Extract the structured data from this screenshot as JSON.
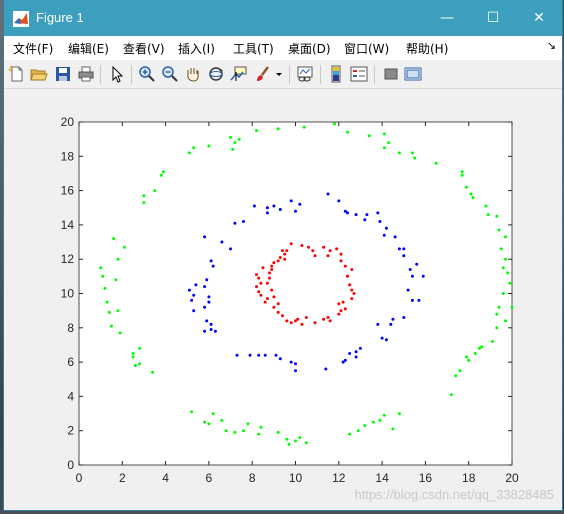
{
  "window": {
    "title": "Figure 1",
    "controls": {
      "minimize": "—",
      "maximize": "☐",
      "close": "✕"
    }
  },
  "menu": {
    "items": [
      "文件(F)",
      "编辑(E)",
      "查看(V)",
      "插入(I)",
      "工具(T)",
      "桌面(D)",
      "窗口(W)",
      "帮助(H)"
    ],
    "overflow": "↘"
  },
  "toolbar": {
    "buttons": [
      "new-figure-icon",
      "open-file-icon",
      "save-icon",
      "print-icon",
      "edit-plot-arrow-icon",
      "zoom-in-icon",
      "zoom-out-icon",
      "pan-hand-icon",
      "rotate-3d-icon",
      "data-cursor-icon",
      "brush-icon",
      "brush-dropdown-icon",
      "link-plot-icon",
      "insert-colorbar-icon",
      "insert-legend-icon",
      "hide-plot-tools-icon",
      "show-plot-tools-icon"
    ]
  },
  "colors": {
    "titlebar": "#3c9fbd",
    "ring_outer": "#00ff00",
    "ring_middle": "#0000ff",
    "ring_inner": "#ff0000"
  },
  "chart_data": {
    "type": "scatter",
    "xlim": [
      0,
      20
    ],
    "ylim": [
      0,
      20
    ],
    "xticks": [
      0,
      2,
      4,
      6,
      8,
      10,
      12,
      14,
      16,
      18,
      20
    ],
    "yticks": [
      0,
      2,
      4,
      6,
      8,
      10,
      12,
      14,
      16,
      18,
      20
    ],
    "grid": false,
    "series": [
      {
        "color": "#00ff00",
        "points": [
          [
            1.0,
            11.5
          ],
          [
            1.1,
            11.0
          ],
          [
            1.2,
            10.3
          ],
          [
            1.3,
            9.5
          ],
          [
            1.4,
            8.9
          ],
          [
            1.5,
            8.1
          ],
          [
            1.8,
            9.0
          ],
          [
            1.7,
            10.8
          ],
          [
            1.9,
            7.7
          ],
          [
            1.6,
            13.2
          ],
          [
            2.1,
            12.7
          ],
          [
            1.8,
            12.0
          ],
          [
            2.5,
            6.3
          ],
          [
            2.6,
            5.8
          ],
          [
            2.8,
            6.8
          ],
          [
            2.5,
            6.5
          ],
          [
            2.8,
            5.9
          ],
          [
            3.4,
            5.4
          ],
          [
            3.0,
            15.3
          ],
          [
            3.0,
            15.7
          ],
          [
            3.5,
            16.0
          ],
          [
            3.8,
            16.9
          ],
          [
            3.9,
            17.1
          ],
          [
            5.1,
            18.2
          ],
          [
            5.3,
            18.5
          ],
          [
            6.0,
            18.6
          ],
          [
            7.0,
            19.1
          ],
          [
            7.2,
            18.8
          ],
          [
            7.1,
            18.4
          ],
          [
            7.4,
            19.0
          ],
          [
            8.2,
            19.5
          ],
          [
            9.2,
            19.6
          ],
          [
            10.4,
            19.7
          ],
          [
            11.8,
            19.9
          ],
          [
            12.4,
            19.4
          ],
          [
            13.4,
            19.2
          ],
          [
            14.1,
            19.3
          ],
          [
            14.3,
            18.8
          ],
          [
            14.1,
            18.5
          ],
          [
            14.8,
            18.2
          ],
          [
            15.4,
            18.2
          ],
          [
            15.5,
            17.9
          ],
          [
            16.5,
            17.6
          ],
          [
            17.7,
            17.1
          ],
          [
            17.7,
            16.9
          ],
          [
            17.9,
            16.2
          ],
          [
            18.1,
            15.8
          ],
          [
            18.2,
            15.6
          ],
          [
            18.8,
            15.1
          ],
          [
            18.9,
            14.6
          ],
          [
            19.3,
            14.5
          ],
          [
            19.4,
            13.7
          ],
          [
            19.7,
            13.3
          ],
          [
            19.5,
            12.6
          ],
          [
            19.7,
            12.0
          ],
          [
            19.6,
            11.5
          ],
          [
            19.8,
            11.2
          ],
          [
            19.9,
            10.6
          ],
          [
            19.6,
            10.0
          ],
          [
            20.0,
            9.2
          ],
          [
            19.4,
            9.2
          ],
          [
            19.3,
            8.8
          ],
          [
            19.7,
            8.4
          ],
          [
            19.3,
            8.0
          ],
          [
            19.1,
            7.2
          ],
          [
            18.6,
            6.9
          ],
          [
            18.5,
            6.8
          ],
          [
            18.3,
            6.5
          ],
          [
            17.9,
            6.3
          ],
          [
            18.0,
            6.1
          ],
          [
            17.6,
            5.5
          ],
          [
            17.4,
            5.2
          ],
          [
            17.2,
            4.1
          ],
          [
            5.2,
            3.1
          ],
          [
            5.8,
            2.5
          ],
          [
            6.0,
            2.4
          ],
          [
            6.2,
            3.0
          ],
          [
            6.6,
            2.6
          ],
          [
            6.8,
            2.0
          ],
          [
            7.2,
            1.9
          ],
          [
            7.6,
            2.0
          ],
          [
            7.8,
            2.4
          ],
          [
            8.3,
            1.8
          ],
          [
            8.4,
            2.2
          ],
          [
            9.2,
            1.9
          ],
          [
            9.6,
            1.5
          ],
          [
            9.7,
            1.2
          ],
          [
            10.0,
            1.4
          ],
          [
            10.2,
            1.6
          ],
          [
            10.5,
            1.3
          ],
          [
            12.5,
            1.8
          ],
          [
            12.9,
            2.0
          ],
          [
            13.2,
            2.3
          ],
          [
            13.6,
            2.5
          ],
          [
            13.9,
            2.6
          ],
          [
            14.1,
            2.9
          ],
          [
            14.8,
            3.0
          ],
          [
            14.5,
            2.1
          ]
        ]
      },
      {
        "color": "#0000ff",
        "points": [
          [
            5.1,
            10.2
          ],
          [
            5.2,
            9.6
          ],
          [
            5.3,
            9.9
          ],
          [
            5.3,
            9.0
          ],
          [
            5.4,
            10.5
          ],
          [
            5.8,
            10.4
          ],
          [
            5.8,
            9.2
          ],
          [
            6.0,
            9.8
          ],
          [
            5.9,
            8.4
          ],
          [
            6.1,
            8.2
          ],
          [
            6.3,
            7.8
          ],
          [
            5.8,
            7.8
          ],
          [
            6.1,
            7.9
          ],
          [
            6.0,
            9.5
          ],
          [
            5.9,
            10.8
          ],
          [
            6.1,
            11.9
          ],
          [
            6.2,
            11.6
          ],
          [
            5.8,
            13.3
          ],
          [
            6.6,
            13.0
          ],
          [
            7.0,
            12.6
          ],
          [
            7.2,
            14.1
          ],
          [
            7.6,
            14.2
          ],
          [
            8.1,
            15.1
          ],
          [
            8.7,
            15.0
          ],
          [
            8.7,
            14.7
          ],
          [
            9.0,
            15.1
          ],
          [
            9.3,
            14.9
          ],
          [
            9.8,
            15.4
          ],
          [
            10.0,
            14.8
          ],
          [
            10.2,
            15.2
          ],
          [
            11.5,
            15.8
          ],
          [
            12.0,
            15.4
          ],
          [
            12.3,
            14.8
          ],
          [
            12.4,
            14.7
          ],
          [
            12.8,
            14.6
          ],
          [
            13.2,
            14.3
          ],
          [
            13.3,
            14.6
          ],
          [
            13.8,
            14.7
          ],
          [
            13.9,
            14.2
          ],
          [
            14.2,
            13.8
          ],
          [
            14.1,
            13.4
          ],
          [
            14.6,
            13.3
          ],
          [
            14.8,
            12.6
          ],
          [
            15.0,
            12.2
          ],
          [
            15.0,
            12.6
          ],
          [
            15.6,
            11.7
          ],
          [
            15.3,
            11.4
          ],
          [
            15.4,
            11.0
          ],
          [
            15.9,
            11.0
          ],
          [
            15.2,
            10.2
          ],
          [
            15.7,
            9.6
          ],
          [
            15.4,
            9.6
          ],
          [
            15.0,
            8.6
          ],
          [
            14.4,
            8.2
          ],
          [
            14.5,
            8.5
          ],
          [
            13.8,
            8.2
          ],
          [
            14.0,
            7.4
          ],
          [
            14.2,
            7.3
          ],
          [
            13.0,
            6.8
          ],
          [
            12.8,
            6.6
          ],
          [
            12.5,
            6.5
          ],
          [
            12.8,
            6.3
          ],
          [
            12.3,
            6.1
          ],
          [
            12.2,
            6.0
          ],
          [
            11.4,
            5.6
          ],
          [
            10.0,
            5.5
          ],
          [
            10.0,
            5.9
          ],
          [
            9.8,
            6.0
          ],
          [
            9.3,
            6.2
          ],
          [
            9.1,
            6.4
          ],
          [
            8.6,
            6.4
          ],
          [
            8.3,
            6.4
          ],
          [
            7.9,
            6.4
          ],
          [
            7.3,
            6.4
          ]
        ]
      },
      {
        "color": "#ff0000",
        "points": [
          [
            8.2,
            11.1
          ],
          [
            8.3,
            10.9
          ],
          [
            8.4,
            10.6
          ],
          [
            8.2,
            10.4
          ],
          [
            8.3,
            10.1
          ],
          [
            8.4,
            9.9
          ],
          [
            8.6,
            9.5
          ],
          [
            8.7,
            9.7
          ],
          [
            8.7,
            10.6
          ],
          [
            8.5,
            11.5
          ],
          [
            8.9,
            11.4
          ],
          [
            8.8,
            11.2
          ],
          [
            8.9,
            10.2
          ],
          [
            9.0,
            9.8
          ],
          [
            9.0,
            11.8
          ],
          [
            9.2,
            11.9
          ],
          [
            9.3,
            12.1
          ],
          [
            9.5,
            12.3
          ],
          [
            9.4,
            12.5
          ],
          [
            9.6,
            12.5
          ],
          [
            9.8,
            12.9
          ],
          [
            10.3,
            12.8
          ],
          [
            10.6,
            12.7
          ],
          [
            10.8,
            12.5
          ],
          [
            10.9,
            12.2
          ],
          [
            11.3,
            12.7
          ],
          [
            11.5,
            12.2
          ],
          [
            11.9,
            12.6
          ],
          [
            12.1,
            12.3
          ],
          [
            12.1,
            11.9
          ],
          [
            12.3,
            11.6
          ],
          [
            12.4,
            11.0
          ],
          [
            12.6,
            11.4
          ],
          [
            12.5,
            10.5
          ],
          [
            12.6,
            10.2
          ],
          [
            12.7,
            10.0
          ],
          [
            12.6,
            9.7
          ],
          [
            12.2,
            9.5
          ],
          [
            12.3,
            9.1
          ],
          [
            12.1,
            9.0
          ],
          [
            12.0,
            8.8
          ],
          [
            11.6,
            8.4
          ],
          [
            11.5,
            8.6
          ],
          [
            11.3,
            8.5
          ],
          [
            10.9,
            8.3
          ],
          [
            10.5,
            8.6
          ],
          [
            10.3,
            8.2
          ],
          [
            10.0,
            8.4
          ],
          [
            9.8,
            8.3
          ],
          [
            9.6,
            8.4
          ],
          [
            9.4,
            8.7
          ],
          [
            9.2,
            8.9
          ],
          [
            9.2,
            9.4
          ],
          [
            9.0,
            9.2
          ],
          [
            8.9,
            11.6
          ],
          [
            9.5,
            12.0
          ],
          [
            11.6,
            12.5
          ],
          [
            12.0,
            9.4
          ],
          [
            10.1,
            8.5
          ],
          [
            8.8,
            10.9
          ]
        ]
      }
    ]
  },
  "watermark": "https://blog.csdn.net/qq_33828485"
}
